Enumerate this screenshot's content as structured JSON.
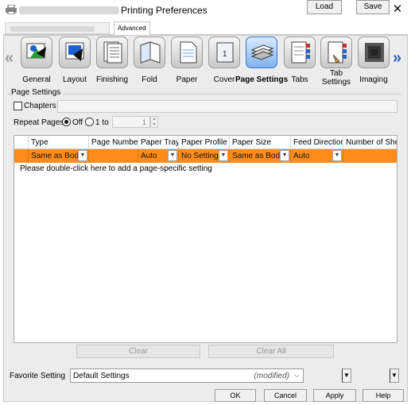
{
  "window": {
    "title": "Printing Preferences",
    "close_glyph": "✕"
  },
  "tabs": {
    "advanced": "Advanced"
  },
  "toolbar": {
    "left_arrow": "«",
    "right_arrow": "»",
    "items": [
      {
        "label": "General",
        "icon": "general-icon"
      },
      {
        "label": "Layout",
        "icon": "layout-icon"
      },
      {
        "label": "Finishing",
        "icon": "finishing-icon"
      },
      {
        "label": "Fold",
        "icon": "fold-icon"
      },
      {
        "label": "Paper",
        "icon": "paper-icon"
      },
      {
        "label": "Cover",
        "icon": "cover-icon"
      },
      {
        "label": "Page Settings",
        "icon": "page-settings-icon",
        "selected": true
      },
      {
        "label": "Tabs",
        "icon": "tabs-icon"
      },
      {
        "label": "Tab Settings",
        "icon": "tab-settings-icon"
      },
      {
        "label": "Imaging",
        "icon": "imaging-icon"
      }
    ]
  },
  "page_settings": {
    "group_title": "Page Settings",
    "chapters_label": "Chapters",
    "repeat_pages_label": "Repeat Pages",
    "off_label": "Off",
    "one_to_label": "1 to",
    "spin_value": "1"
  },
  "table": {
    "headers": [
      "Type",
      "Page Number",
      "Paper Tray",
      "Paper Profile",
      "Paper Size",
      "Feed Direction",
      "Number of She"
    ],
    "row": [
      "Same as Body",
      "",
      "Auto",
      "No Setting",
      "Same as Body",
      "Auto",
      ""
    ],
    "hint": "Please double-click here to add a page-specific setting"
  },
  "buttons": {
    "clear": "Clear",
    "clear_all": "Clear All",
    "load": "Load",
    "save": "Save",
    "ok": "OK",
    "cancel": "Cancel",
    "apply": "Apply",
    "help": "Help"
  },
  "favorite": {
    "label": "Favorite Setting",
    "value": "Default Settings",
    "modified": "(modified)"
  },
  "colors": {
    "selected_row": "#ff8c1a",
    "selected_tool": "#7fb2f0"
  }
}
